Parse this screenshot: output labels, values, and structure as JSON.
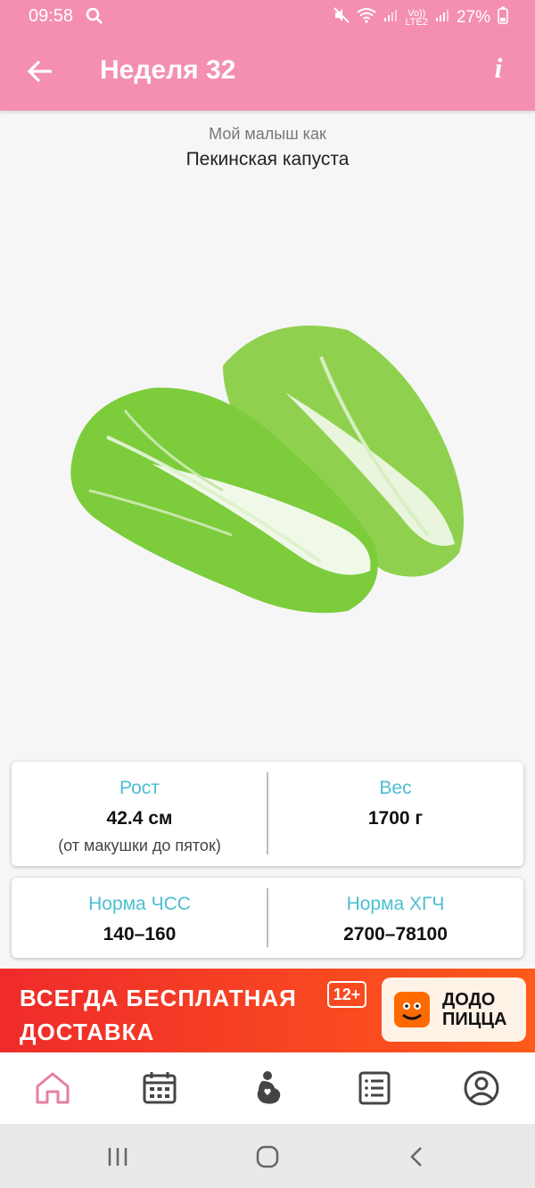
{
  "status_bar": {
    "time": "09:58",
    "network_top": "Vo))",
    "network_bottom": "LTE2",
    "battery": "27%"
  },
  "app_bar": {
    "title": "Неделя 32",
    "info_label": "i"
  },
  "caption": {
    "intro": "Мой малыш как",
    "comparison": "Пекинская капуста"
  },
  "illustration": {
    "icon": "napa-cabbage-icon"
  },
  "stats": {
    "height": {
      "label": "Рост",
      "value": "42.4 см",
      "note": "(от макушки до пяток)"
    },
    "weight": {
      "label": "Вес",
      "value": "1700 г"
    },
    "heart_rate": {
      "label": "Норма ЧСС",
      "value": "140–160"
    },
    "hcg": {
      "label": "Норма ХГЧ",
      "value": "2700–78100"
    }
  },
  "ad": {
    "line1": "ВСЕГДА БЕСПЛАТНАЯ",
    "line2": "ДОСТАВКА",
    "age_rating": "12+",
    "brand_line1": "ДОДО",
    "brand_line2": "ПИЦЦА"
  },
  "bottom_nav": {
    "items": [
      {
        "icon": "home-icon",
        "active": true
      },
      {
        "icon": "calendar-icon",
        "active": false
      },
      {
        "icon": "pregnancy-icon",
        "active": false
      },
      {
        "icon": "checklist-icon",
        "active": false
      },
      {
        "icon": "profile-icon",
        "active": false
      }
    ]
  },
  "colors": {
    "primary": "#f48fb1",
    "label": "#4bbfd1",
    "nav_active": "#e57fa3",
    "nav_inactive": "#444444"
  }
}
